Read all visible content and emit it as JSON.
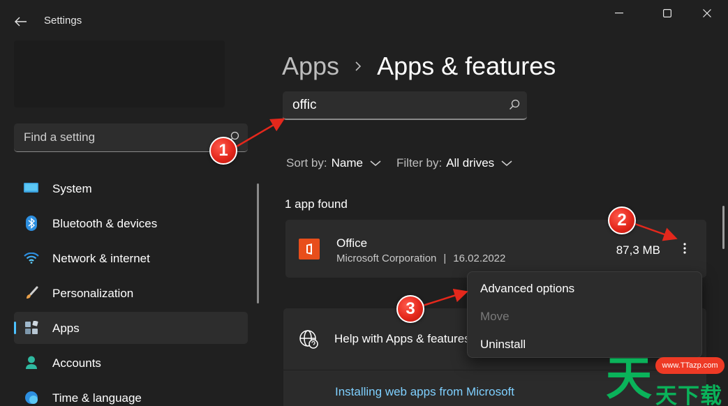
{
  "window": {
    "title": "Settings",
    "controls": [
      "minimize",
      "maximize",
      "close"
    ]
  },
  "sidebar": {
    "search_placeholder": "Find a setting",
    "items": [
      {
        "label": "System",
        "icon": "monitor-icon",
        "selected": false
      },
      {
        "label": "Bluetooth & devices",
        "icon": "bluetooth-icon",
        "selected": false
      },
      {
        "label": "Network & internet",
        "icon": "wifi-icon",
        "selected": false
      },
      {
        "label": "Personalization",
        "icon": "brush-icon",
        "selected": false
      },
      {
        "label": "Apps",
        "icon": "apps-icon",
        "selected": true
      },
      {
        "label": "Accounts",
        "icon": "person-icon",
        "selected": false
      },
      {
        "label": "Time & language",
        "icon": "globe-clock-icon",
        "selected": false
      }
    ]
  },
  "main": {
    "breadcrumb": {
      "parent": "Apps",
      "current": "Apps & features"
    },
    "search": {
      "value": "offic"
    },
    "sort": {
      "label": "Sort by:",
      "value": "Name"
    },
    "filter": {
      "label": "Filter by:",
      "value": "All drives"
    },
    "result_count": "1 app found",
    "app": {
      "name": "Office",
      "publisher": "Microsoft Corporation",
      "separator": "|",
      "date": "16.02.2022",
      "size": "87,3 MB"
    },
    "context_menu": {
      "items": [
        {
          "label": "Advanced options",
          "enabled": true
        },
        {
          "label": "Move",
          "enabled": false
        },
        {
          "label": "Uninstall",
          "enabled": true
        }
      ]
    },
    "help": {
      "title": "Help with Apps & features",
      "link": "Installing web apps from Microsoft"
    }
  },
  "annotations": {
    "badges": [
      "1",
      "2",
      "3"
    ],
    "color": "#e4281c"
  },
  "watermark": {
    "big": "天",
    "url": "www.TTazp.com",
    "small": "天下载"
  },
  "colors": {
    "background": "#202020",
    "card": "#2b2b2b",
    "accent": "#4cc2ff",
    "link": "#7fd0ff",
    "office": "#e84e1b"
  }
}
